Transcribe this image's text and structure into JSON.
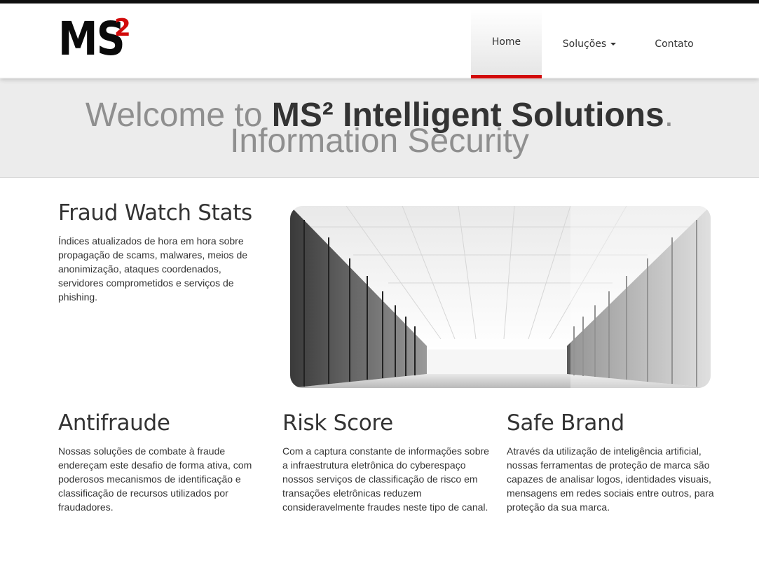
{
  "header": {
    "logo": "MS²",
    "nav": [
      {
        "label": "Home",
        "active": true
      },
      {
        "label": "Soluções",
        "dropdown": true
      },
      {
        "label": "Contato"
      }
    ]
  },
  "hero": {
    "welcome_prefix": "Welcome to ",
    "brand": "MS² Intelligent Solutions",
    "welcome_suffix": ".",
    "subtitle": "Information Security"
  },
  "fraud_watch": {
    "title": "Fraud Watch Stats",
    "text": "Índices atualizados de hora em hora sobre propagação de scams, malwares, meios de anonimização, ataques coordenados, servidores comprometidos e serviços de phishing."
  },
  "features": [
    {
      "title": "Antifraude",
      "text": "Nossas soluções de combate à fraude endereçam este desafio de forma ativa, com poderosos mecanismos de identificação e classificação de recursos utilizados por fraudadores."
    },
    {
      "title": "Risk Score",
      "text": "Com a captura constante de informações sobre a infraestrutura eletrônica do cyberespaço nossos serviços de classificação de risco em transações eletrônicas reduzem consideravelmente fraudes neste tipo de canal."
    },
    {
      "title": "Safe Brand",
      "text": "Através da utilização de inteligência artificial, nossas ferramentas de proteção de marca são capazes de analisar logos, identidades visuais, mensagens em redes sociais entre outros, para proteção da sua marca."
    }
  ],
  "colors": {
    "accent": "#d20a0a",
    "text": "#333333",
    "hero_bg": "#ececec",
    "hero_muted": "#8f8f8f"
  }
}
